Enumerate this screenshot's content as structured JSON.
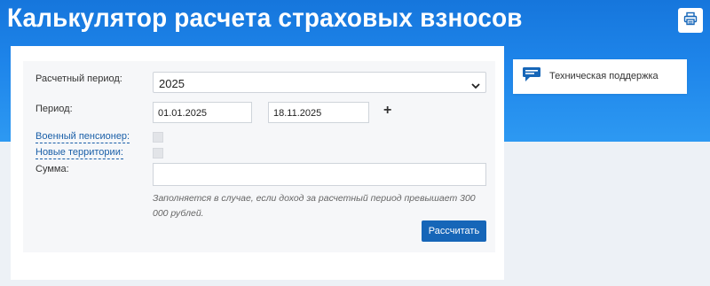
{
  "header": {
    "title": "Калькулятор расчета страховых взносов",
    "print_icon": "printer-icon"
  },
  "support": {
    "icon": "chat-bubble-icon",
    "label": "Техническая поддержка"
  },
  "form": {
    "period_label": "Расчетный период:",
    "period_value": "2025",
    "range_label": "Период:",
    "date_from": "01.01.2025",
    "date_to": "18.11.2025",
    "add_symbol": "+",
    "military_label": "Военный пенсионер:",
    "new_territories_label": "Новые территории:",
    "sum_label": "Сумма:",
    "sum_value": "",
    "hint": "Заполняется в случае, если доход за расчетный период превышает 300 000 рублей.",
    "submit_label": "Рассчитать"
  },
  "colors": {
    "header_blue": "#1e85ea",
    "button_blue": "#1666b8",
    "link_blue": "#1a5fa8"
  }
}
